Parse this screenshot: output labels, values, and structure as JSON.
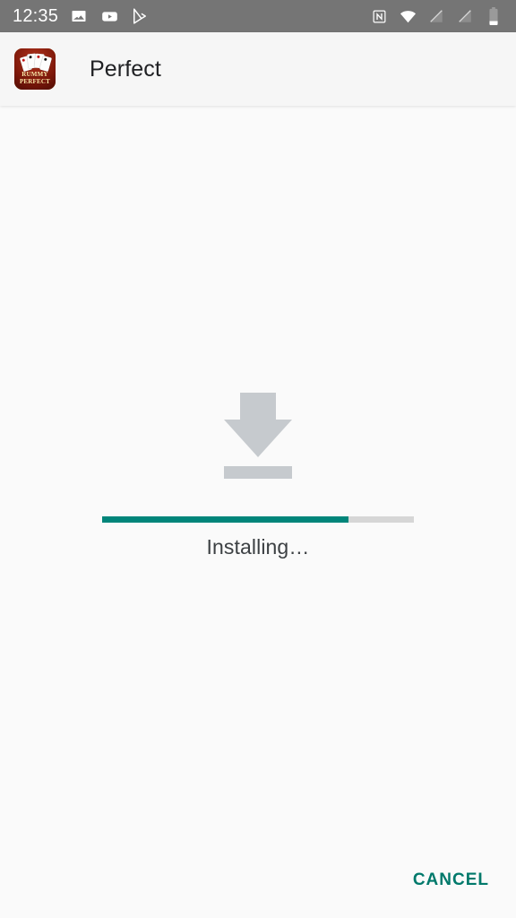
{
  "status_bar": {
    "clock": "12:35",
    "background_color": "#757575",
    "notification_icons": [
      {
        "name": "photo-icon",
        "label": "Screenshot"
      },
      {
        "name": "youtube-icon",
        "label": "YouTube"
      },
      {
        "name": "google-play-icon",
        "label": "Google Play"
      }
    ],
    "system_icons": [
      {
        "name": "nfc-icon",
        "label": "NFC"
      },
      {
        "name": "wifi-icon",
        "label": "Wi-Fi"
      },
      {
        "name": "signal-off-1-icon",
        "label": "No SIM 1"
      },
      {
        "name": "signal-off-2-icon",
        "label": "No SIM 2"
      },
      {
        "name": "battery-icon",
        "label": "Battery low"
      }
    ]
  },
  "toolbar": {
    "title": "Perfect",
    "app_icon": {
      "name": "rummy-perfect-app-icon",
      "line1": "RUMMY",
      "line2": "PERFECT"
    }
  },
  "install": {
    "icon_name": "download-arrow-icon",
    "status_text": "Installing…",
    "progress_percent": 79,
    "progress_fill_color": "#00857a",
    "progress_track_color": "#d6d6d6",
    "icon_color": "#c6cace"
  },
  "footer": {
    "cancel_label": "CANCEL",
    "accent_color": "#00796b"
  }
}
